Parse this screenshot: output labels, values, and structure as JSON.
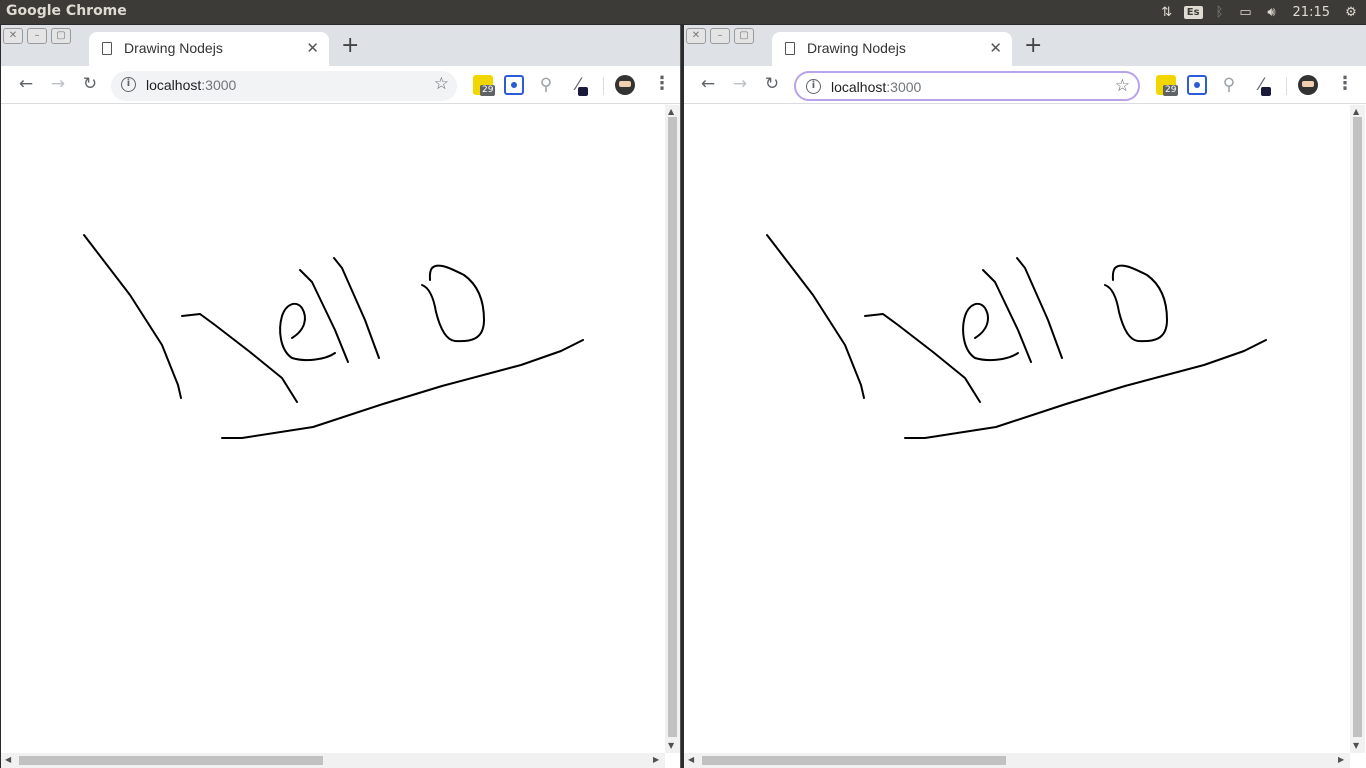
{
  "system_bar": {
    "app_title": "Google Chrome",
    "keyboard_layout": "Es",
    "clock": "21:15",
    "icons": [
      "network-arrows-icon",
      "bluetooth-icon",
      "battery-icon",
      "volume-icon",
      "settings-gear-icon"
    ]
  },
  "windows": [
    {
      "tab_title": "Drawing Nodejs",
      "url_host": "localhost",
      "url_port": ":3000",
      "extension_badge": "29",
      "omnibox_focused": false
    },
    {
      "tab_title": "Drawing Nodejs",
      "url_host": "localhost",
      "url_port": ":3000",
      "extension_badge": "29",
      "omnibox_focused": true
    }
  ],
  "drawing": {
    "stroke_color": "#000000",
    "content": "hello"
  }
}
